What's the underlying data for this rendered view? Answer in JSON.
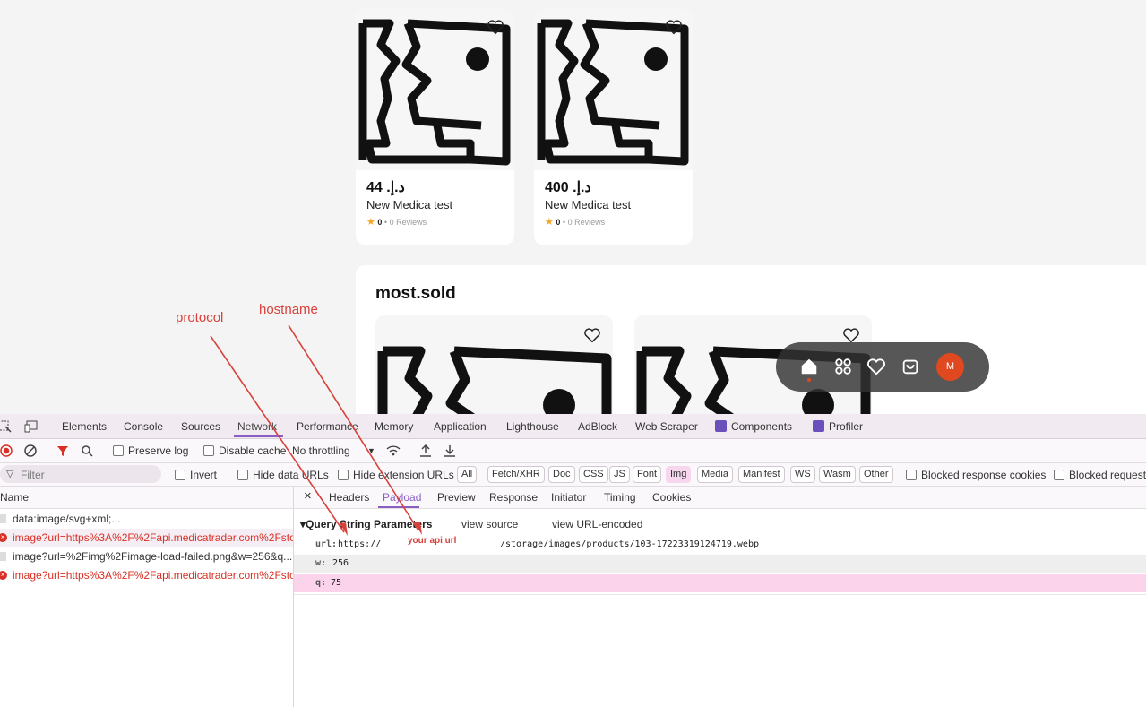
{
  "products": [
    {
      "price": "د.إ. 44",
      "name": "New Medica test",
      "rating": "0",
      "reviews": "• 0 Reviews"
    },
    {
      "price": "د.إ. 400",
      "name": "New Medica test",
      "rating": "0",
      "reviews": "• 0 Reviews"
    }
  ],
  "section": {
    "title": "most.sold"
  },
  "floatnav": {
    "avatar_initial": "M"
  },
  "devtools": {
    "tabs": [
      "Elements",
      "Console",
      "Sources",
      "Network",
      "Performance",
      "Memory",
      "Application",
      "Lighthouse",
      "AdBlock",
      "Web Scraper",
      "Components",
      "Profiler"
    ],
    "toolbar": {
      "preserve_log": "Preserve log",
      "disable_cache": "Disable cache",
      "throttling": "No throttling"
    },
    "filter": {
      "placeholder": "Filter",
      "invert": "Invert",
      "hide_data_urls": "Hide data URLs",
      "hide_extension_urls": "Hide extension URLs",
      "chips": [
        "All",
        "Fetch/XHR",
        "Doc",
        "CSS",
        "JS",
        "Font",
        "Img",
        "Media",
        "Manifest",
        "WS",
        "Wasm",
        "Other"
      ],
      "blocked_cookies": "Blocked response cookies",
      "blocked_requests": "Blocked requests"
    },
    "name_header": "Name",
    "requests": [
      "data:image/svg+xml;...",
      "image?url=https%3A%2F%2Fapi.medicatrader.com%2Fsto...",
      "image?url=%2Fimg%2Fimage-load-failed.png&w=256&q...",
      "image?url=https%3A%2F%2Fapi.medicatrader.com%2Fsto..."
    ],
    "detail_tabs": [
      "Headers",
      "Payload",
      "Preview",
      "Response",
      "Initiator",
      "Timing",
      "Cookies"
    ],
    "payload": {
      "section_title": "Query String Parameters",
      "view_source": "view source",
      "view_url_encoded": "view URL-encoded",
      "params": [
        {
          "key": "url:",
          "value_prefix": "https://",
          "value_suffix": "/storage/images/products/103-17223319124719.webp"
        },
        {
          "key": "w:",
          "value": "256"
        },
        {
          "key": "q:",
          "value": "75"
        }
      ]
    }
  },
  "annotations": {
    "protocol": "protocol",
    "hostname": "hostname",
    "api_url": "your api url"
  },
  "colors": {
    "accent": "#8a5fc4",
    "error": "#d93025",
    "annotation": "#d9403a",
    "avatar": "#e0481f"
  }
}
